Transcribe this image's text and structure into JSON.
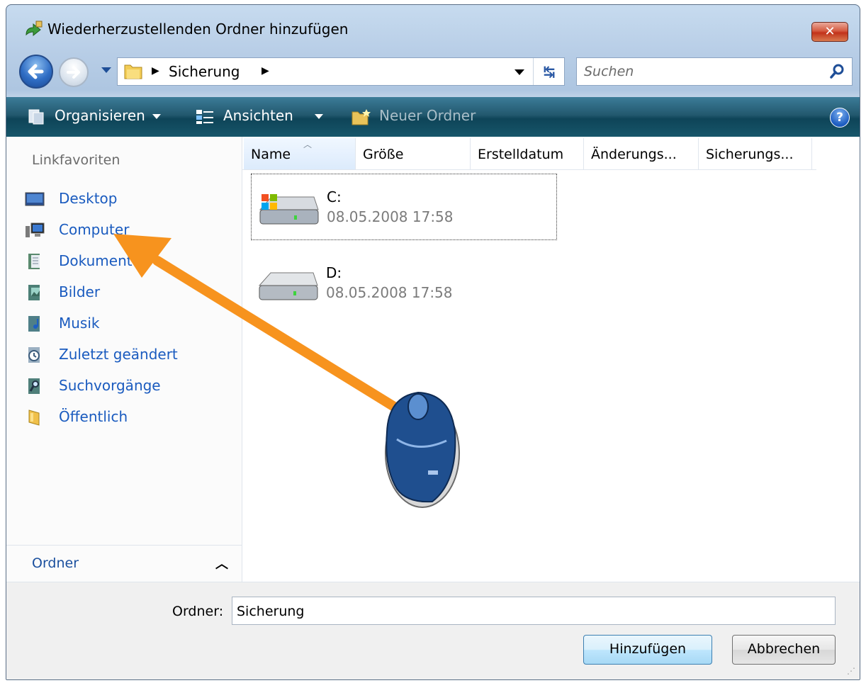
{
  "window": {
    "title": "Wiederherzustellenden Ordner hinzufügen",
    "close_label": "✕"
  },
  "navigation": {
    "address_path": "Sicherung",
    "search_placeholder": "Suchen"
  },
  "toolbar": {
    "organize_label": "Organisieren",
    "views_label": "Ansichten",
    "new_folder_label": "Neuer Ordner",
    "help_label": "?"
  },
  "sidebar": {
    "heading": "Linkfavoriten",
    "items": [
      {
        "label": "Desktop",
        "icon": "desktop-icon"
      },
      {
        "label": "Computer",
        "icon": "computer-icon"
      },
      {
        "label": "Dokumente",
        "icon": "documents-icon"
      },
      {
        "label": "Bilder",
        "icon": "pictures-icon"
      },
      {
        "label": "Musik",
        "icon": "music-icon"
      },
      {
        "label": "Zuletzt geändert",
        "icon": "recent-icon"
      },
      {
        "label": "Suchvorgänge",
        "icon": "searches-icon"
      },
      {
        "label": "Öffentlich",
        "icon": "public-folder-icon"
      }
    ],
    "folders_toggle_label": "Ordner"
  },
  "file_list": {
    "columns": [
      "Name",
      "Größe",
      "Erstelldatum",
      "Änderungs...",
      "Sicherungs..."
    ],
    "items": [
      {
        "name": "C:",
        "date": "08.05.2008 17:58",
        "icon": "system-drive-icon"
      },
      {
        "name": "D:",
        "date": "08.05.2008 17:58",
        "icon": "drive-icon"
      }
    ]
  },
  "footer": {
    "folder_label": "Ordner:",
    "folder_value": "Sicherung",
    "add_button": "Hinzufügen",
    "cancel_button": "Abbrechen"
  },
  "colors": {
    "link_blue": "#1a5bbf",
    "toolbar_teal": "#17566a",
    "arrow_orange": "#f7931e",
    "mouse_blue": "#1f4f8f"
  }
}
